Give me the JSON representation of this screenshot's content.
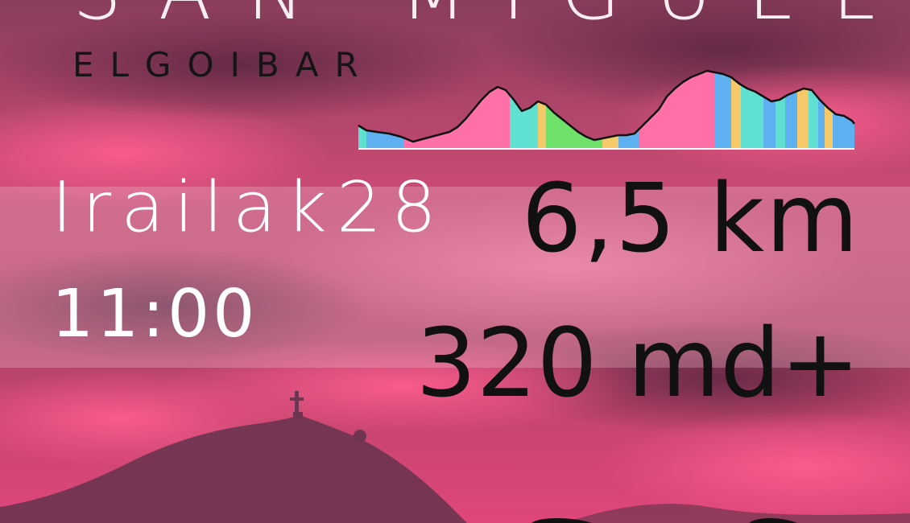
{
  "event": {
    "title": "SAN MIGUEL",
    "location": "ELGOIBAR",
    "date": "Irailak28",
    "time": "11:00",
    "distance": "6,5 km",
    "elevation": "320 md+"
  },
  "profile_segment_colors": [
    "#5fb0f0",
    "#f5c96a",
    "#ff6fa8",
    "#5fe0d0",
    "#6fe06a"
  ],
  "theme": {
    "background": "#d8436f",
    "dark": "#6b3049",
    "text_light": "#ffffff",
    "text_dark": "#111111"
  }
}
